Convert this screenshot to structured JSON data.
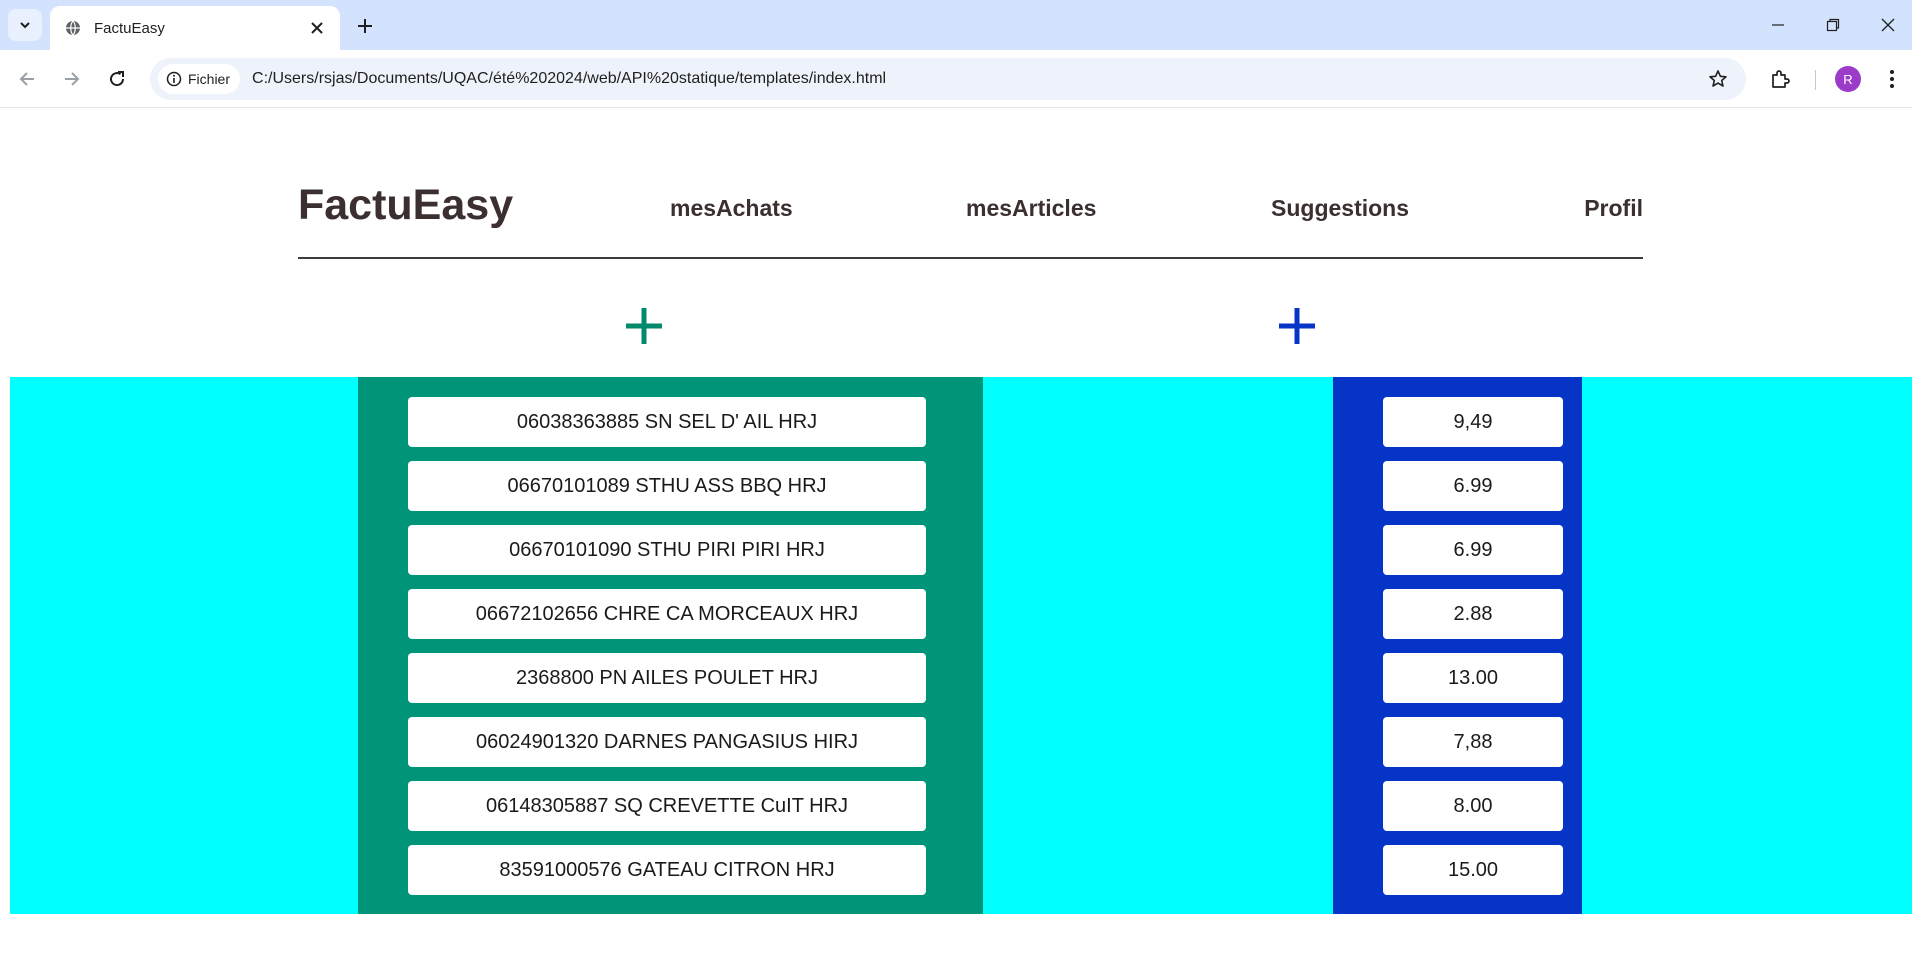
{
  "browser": {
    "tab_title": "FactuEasy",
    "site_chip": "Fichier",
    "url": "C:/Users/rsjas/Documents/UQAC/été%202024/web/API%20statique/templates/index.html",
    "profile_initial": "R"
  },
  "header": {
    "logo": "FactuEasy",
    "nav": [
      "mesAchats",
      "mesArticles",
      "Suggestions",
      "Profil"
    ]
  },
  "colors": {
    "band": "#00ffff",
    "articles_column": "#009479",
    "prices_column": "#0534c7",
    "plus_green": "#00896d",
    "plus_blue": "#0534c7"
  },
  "articles": [
    "06038363885 SN SEL D' AIL HRJ",
    "06670101089 STHU ASS BBQ HRJ",
    "06670101090 STHU PIRI PIRI HRJ",
    "06672102656 CHRE CA MORCEAUX HRJ",
    "2368800 PN AILES POULET HRJ",
    "06024901320 DARNES PANGASIUS HIRJ",
    "06148305887 SQ CREVETTE CuIT HRJ",
    "83591000576 GATEAU CITRON HRJ"
  ],
  "prices": [
    "9,49",
    "6.99",
    "6.99",
    "2.88",
    "13.00",
    "7,88",
    "8.00",
    "15.00"
  ]
}
